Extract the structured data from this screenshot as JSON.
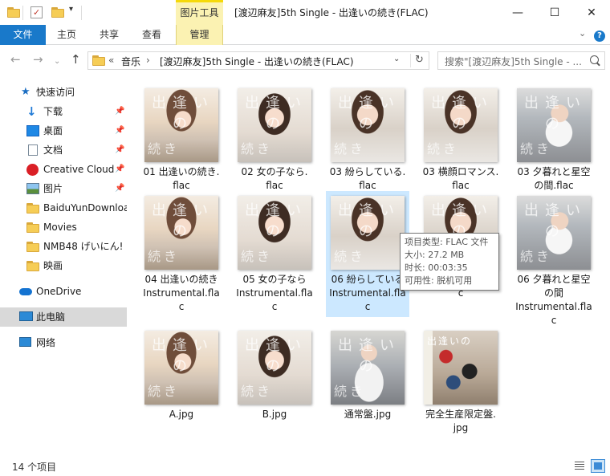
{
  "window": {
    "title": "[渡辺麻友]5th Single - 出逢いの続き(FLAC)",
    "context_tab": "图片工具",
    "controls": [
      "—",
      "☐",
      "✕"
    ]
  },
  "ribbon": {
    "tabs": [
      "文件",
      "主页",
      "共享",
      "查看",
      "管理"
    ]
  },
  "address": {
    "overflow": "«",
    "crumbs": [
      "音乐",
      "[渡辺麻友]5th Single - 出逢いの続き(FLAC)"
    ],
    "separator": "›"
  },
  "search": {
    "placeholder": "搜索\"[渡辺麻友]5th Single - ..."
  },
  "sidebar": {
    "items": [
      {
        "label": "快速访问",
        "icon": "star-icon"
      },
      {
        "label": "下载",
        "icon": "download-icon",
        "pinned": true
      },
      {
        "label": "桌面",
        "icon": "desktop-icon",
        "pinned": true
      },
      {
        "label": "文档",
        "icon": "document-icon",
        "pinned": true
      },
      {
        "label": "Creative Cloud",
        "icon": "creative-cloud-icon",
        "pinned": true
      },
      {
        "label": "图片",
        "icon": "pictures-icon",
        "pinned": true
      },
      {
        "label": "BaiduYunDownload",
        "icon": "folder-icon"
      },
      {
        "label": "Movies",
        "icon": "folder-icon"
      },
      {
        "label": "NMB48 げいにん!",
        "icon": "folder-icon"
      },
      {
        "label": "映画",
        "icon": "folder-icon"
      },
      {
        "label": "OneDrive",
        "icon": "cloud-icon"
      },
      {
        "label": "此电脑",
        "icon": "computer-icon",
        "selected": true
      },
      {
        "label": "网络",
        "icon": "network-icon"
      }
    ]
  },
  "files": [
    {
      "name": "01 出逢いの続き.flac",
      "lines": [
        "01 出逢いの続き.",
        "flac"
      ]
    },
    {
      "name": "02 女の子なら.flac",
      "lines": [
        "02 女の子なら.",
        "flac"
      ]
    },
    {
      "name": "03 紛らしている.flac",
      "lines": [
        "03 紛らしている.",
        "flac"
      ]
    },
    {
      "name": "03 横顔ロマンス.flac",
      "lines": [
        "03 横顔ロマンス.",
        "flac"
      ]
    },
    {
      "name": "03 夕暮れと星空の間.flac",
      "lines": [
        "03 夕暮れと星空",
        "の間.flac"
      ]
    },
    {
      "name": "04 出逢いの続き Instrumental.flac",
      "lines": [
        "04 出逢いの続き",
        "Instrumental.fla",
        "c"
      ]
    },
    {
      "name": "05 女の子なら Instrumental.flac",
      "lines": [
        "05 女の子なら",
        "Instrumental.fla",
        "c"
      ]
    },
    {
      "name": "06 紛らしている Instrumental.flac",
      "lines": [
        "06 紛らしている",
        "Instrumental.fla",
        "c"
      ]
    },
    {
      "name": "Instrumental.flac",
      "lines": [
        "Instrumental.fla",
        "c"
      ]
    },
    {
      "name": "06 夕暮れと星空の間 Instrumental.flac",
      "lines": [
        "06 夕暮れと星空",
        "の間",
        "Instrumental.fla",
        "c"
      ]
    },
    {
      "name": "A.jpg",
      "lines": [
        "A.jpg"
      ]
    },
    {
      "name": "B.jpg",
      "lines": [
        "B.jpg"
      ]
    },
    {
      "name": "通常盤.jpg",
      "lines": [
        "通常盤.jpg"
      ]
    },
    {
      "name": "完全生産限定盤.jpg",
      "lines": [
        "完全生産限定盤.",
        "jpg"
      ]
    }
  ],
  "thumb_text": {
    "top": "出逢いの",
    "bottom": "続き"
  },
  "tooltip": {
    "type": "项目类型: FLAC 文件",
    "size": "大小: 27.2 MB",
    "duration": "时长: 00:03:35",
    "availability": "可用性: 脱机可用"
  },
  "status": {
    "count": "14 个项目"
  },
  "colors": {
    "file_tab": "#1979ca",
    "context_tab": "#fbf2b2",
    "selection": "#cce8ff",
    "sidebar_selected": "#d9d9d9"
  }
}
